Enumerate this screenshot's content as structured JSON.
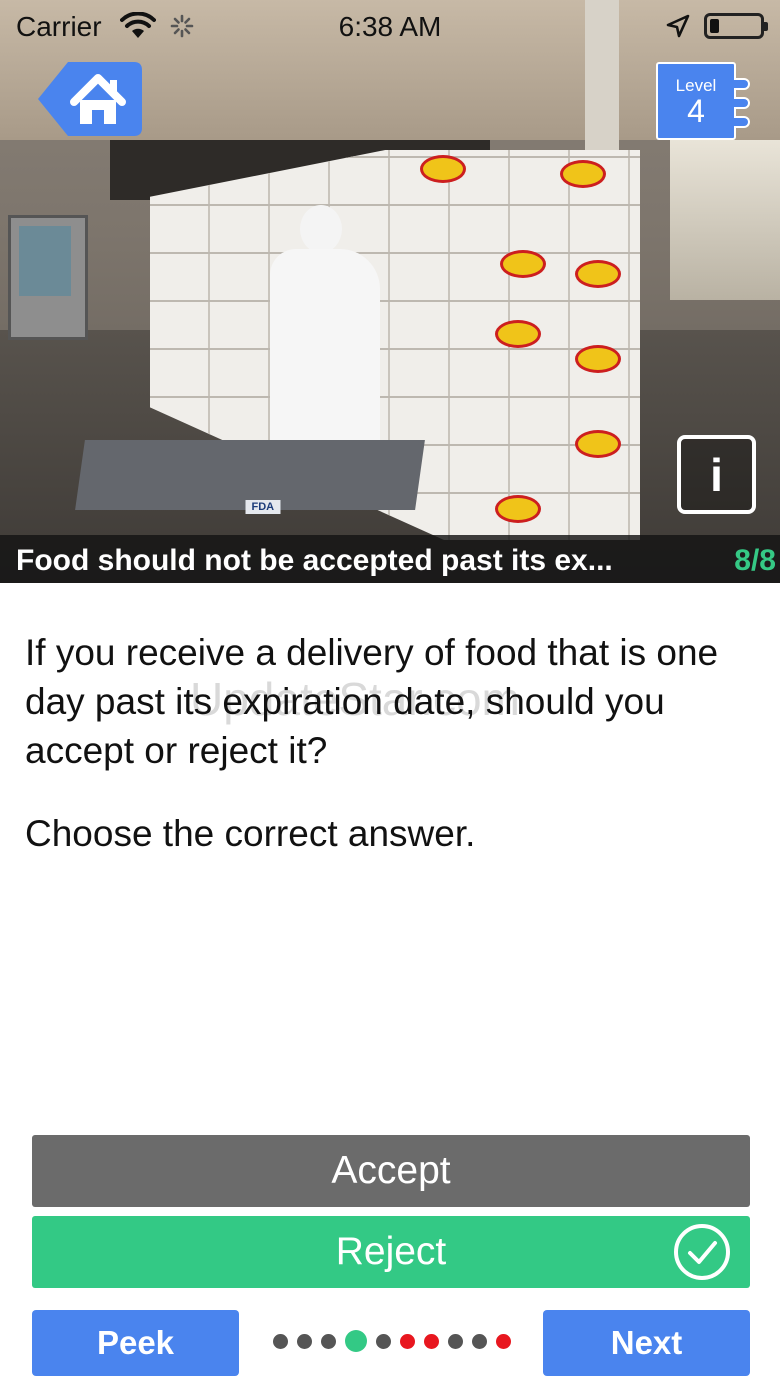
{
  "status_bar": {
    "carrier": "Carrier",
    "time": "6:38 AM"
  },
  "header": {
    "home_icon": "home-icon",
    "level_label": "Level",
    "level_number": "4"
  },
  "photo": {
    "caption": "Food should not be accepted past its ex...",
    "counter": "8/8",
    "info_label": "i",
    "cart_label": "FDA"
  },
  "question": {
    "text": "If you receive a delivery of food that is one day past its expiration date, should you accept or reject it?",
    "prompt": "Choose the correct answer.",
    "watermark": "UpdateStar.com"
  },
  "answers": [
    {
      "label": "Accept",
      "state": "neutral"
    },
    {
      "label": "Reject",
      "state": "correct"
    }
  ],
  "controls": {
    "peek_label": "Peek",
    "next_label": "Next"
  },
  "progress_dots": [
    {
      "state": "done"
    },
    {
      "state": "done"
    },
    {
      "state": "done"
    },
    {
      "state": "current"
    },
    {
      "state": "done"
    },
    {
      "state": "wrong"
    },
    {
      "state": "wrong"
    },
    {
      "state": "done"
    },
    {
      "state": "done"
    },
    {
      "state": "wrong"
    }
  ],
  "colors": {
    "accent_blue": "#4a84ee",
    "correct_green": "#33c985",
    "neutral_gray": "#6b6b6b",
    "dot_gray": "#555555",
    "dot_red": "#e8171f",
    "dot_green": "#33c985"
  }
}
